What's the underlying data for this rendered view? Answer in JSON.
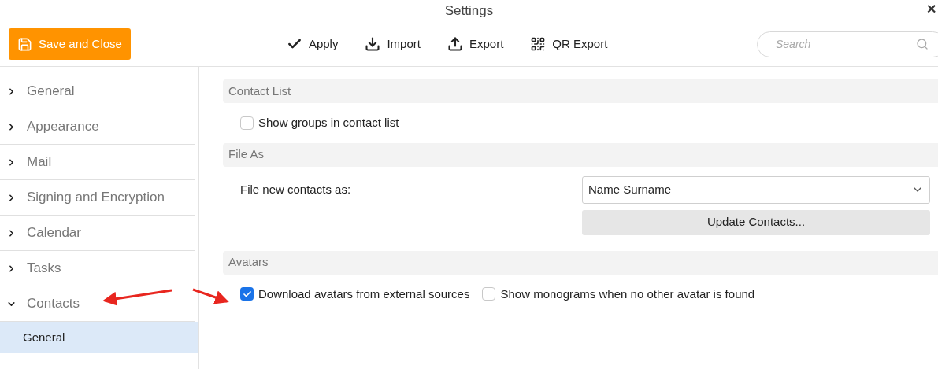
{
  "window": {
    "title": "Settings",
    "close": "✕"
  },
  "toolbar": {
    "save_button": "Save and Close",
    "actions": [
      {
        "kind": "apply",
        "label": "Apply"
      },
      {
        "kind": "import",
        "label": "Import"
      },
      {
        "kind": "export",
        "label": "Export"
      },
      {
        "kind": "qr",
        "label": "QR Export"
      }
    ],
    "search": {
      "placeholder": "Search"
    }
  },
  "sidebar": {
    "items": [
      {
        "label": "General",
        "expanded": false
      },
      {
        "label": "Appearance",
        "expanded": false
      },
      {
        "label": "Mail",
        "expanded": false
      },
      {
        "label": "Signing and Encryption",
        "expanded": false
      },
      {
        "label": "Calendar",
        "expanded": false
      },
      {
        "label": "Tasks",
        "expanded": false
      },
      {
        "label": "Contacts",
        "expanded": true,
        "children": [
          {
            "label": "General",
            "selected": true
          }
        ]
      }
    ]
  },
  "sections": [
    {
      "title": "Contact List",
      "rows": [
        {
          "kind": "checkboxes",
          "options": [
            {
              "label": "Show groups in contact list",
              "checked": false
            }
          ]
        }
      ]
    },
    {
      "title": "File As",
      "rows": [
        {
          "kind": "dropdown",
          "label": "File new contacts as:",
          "value": "Name Surname"
        },
        {
          "kind": "button",
          "label": "Update Contacts..."
        }
      ]
    },
    {
      "title": "Avatars",
      "rows": [
        {
          "kind": "checkboxes",
          "options": [
            {
              "label": "Download avatars from external sources",
              "checked": true
            },
            {
              "label": "Show monograms when no other avatar is found",
              "checked": false
            }
          ]
        }
      ]
    }
  ]
}
